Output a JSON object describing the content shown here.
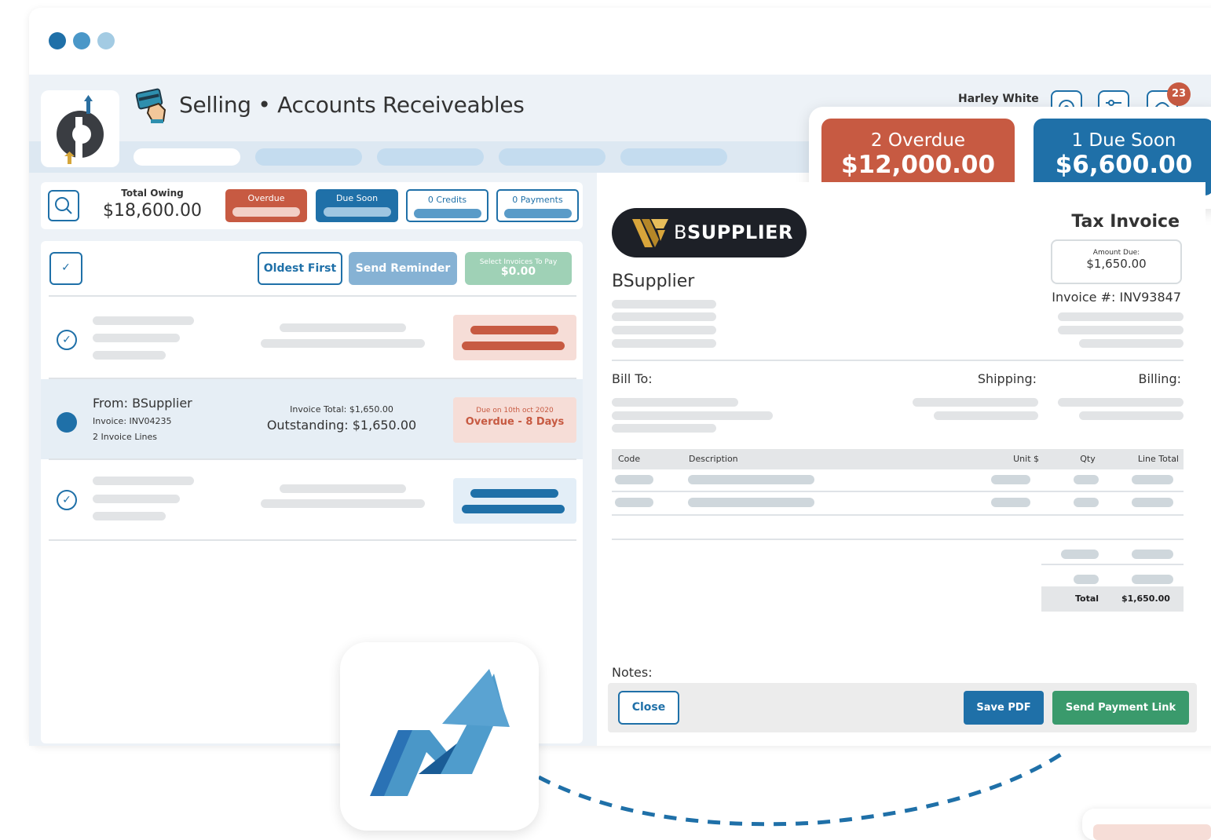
{
  "window": {
    "title": "Selling • Accounts Receiveables",
    "dots": [
      "#1f70a8",
      "#4a97c8",
      "#a3cbe3"
    ]
  },
  "header": {
    "user_name": "Harley White",
    "notification_count": "23",
    "icons": [
      "location-icon",
      "settings-sliders-icon",
      "notification-icon"
    ]
  },
  "summary": {
    "overdue": {
      "label": "2 Overdue",
      "amount": "$12,000.00",
      "color": "#c75a42"
    },
    "due_soon": {
      "label": "1 Due Soon",
      "amount": "$6,600.00",
      "color": "#1f70a8"
    }
  },
  "filters": {
    "total_owing_label": "Total Owing",
    "total_owing_value": "$18,600.00",
    "overdue_label": "Overdue",
    "due_soon_label": "Due Soon",
    "credits_label": "0 Credits",
    "payments_label": "0 Payments"
  },
  "list_toolbar": {
    "check_mark": "✓",
    "oldest_first": "Oldest First",
    "send_reminder": "Send Reminder",
    "select_invoices_label": "Select Invoices To Pay",
    "select_invoices_amount": "$0.00"
  },
  "selected_invoice": {
    "from": "From: BSupplier",
    "invoice": "Invoice: INV04235",
    "lines": "2 Invoice Lines",
    "total": "Invoice Total: $1,650.00",
    "outstanding": "Outstanding: $1,650.00",
    "due_on": "Due on 10th oct 2020",
    "overdue_days": "Overdue - 8 Days"
  },
  "invoice": {
    "brand_prefix": "B",
    "brand_suffix": "SUPPLIER",
    "supplier_name": "BSupplier",
    "doc_title": "Tax Invoice",
    "amount_due_label": "Amount Due:",
    "amount_due_value": "$1,650.00",
    "invoice_number": "Invoice #: INV93847",
    "bill_to": "Bill To:",
    "shipping": "Shipping:",
    "billing": "Billing:",
    "columns": [
      "Code",
      "Description",
      "Unit $",
      "Qty",
      "Line Total"
    ],
    "total_label": "Total",
    "total_value": "$1,650.00",
    "notes_label": "Notes:"
  },
  "actions": {
    "close": "Close",
    "save_pdf": "Save PDF",
    "send_payment_link": "Send Payment Link"
  }
}
